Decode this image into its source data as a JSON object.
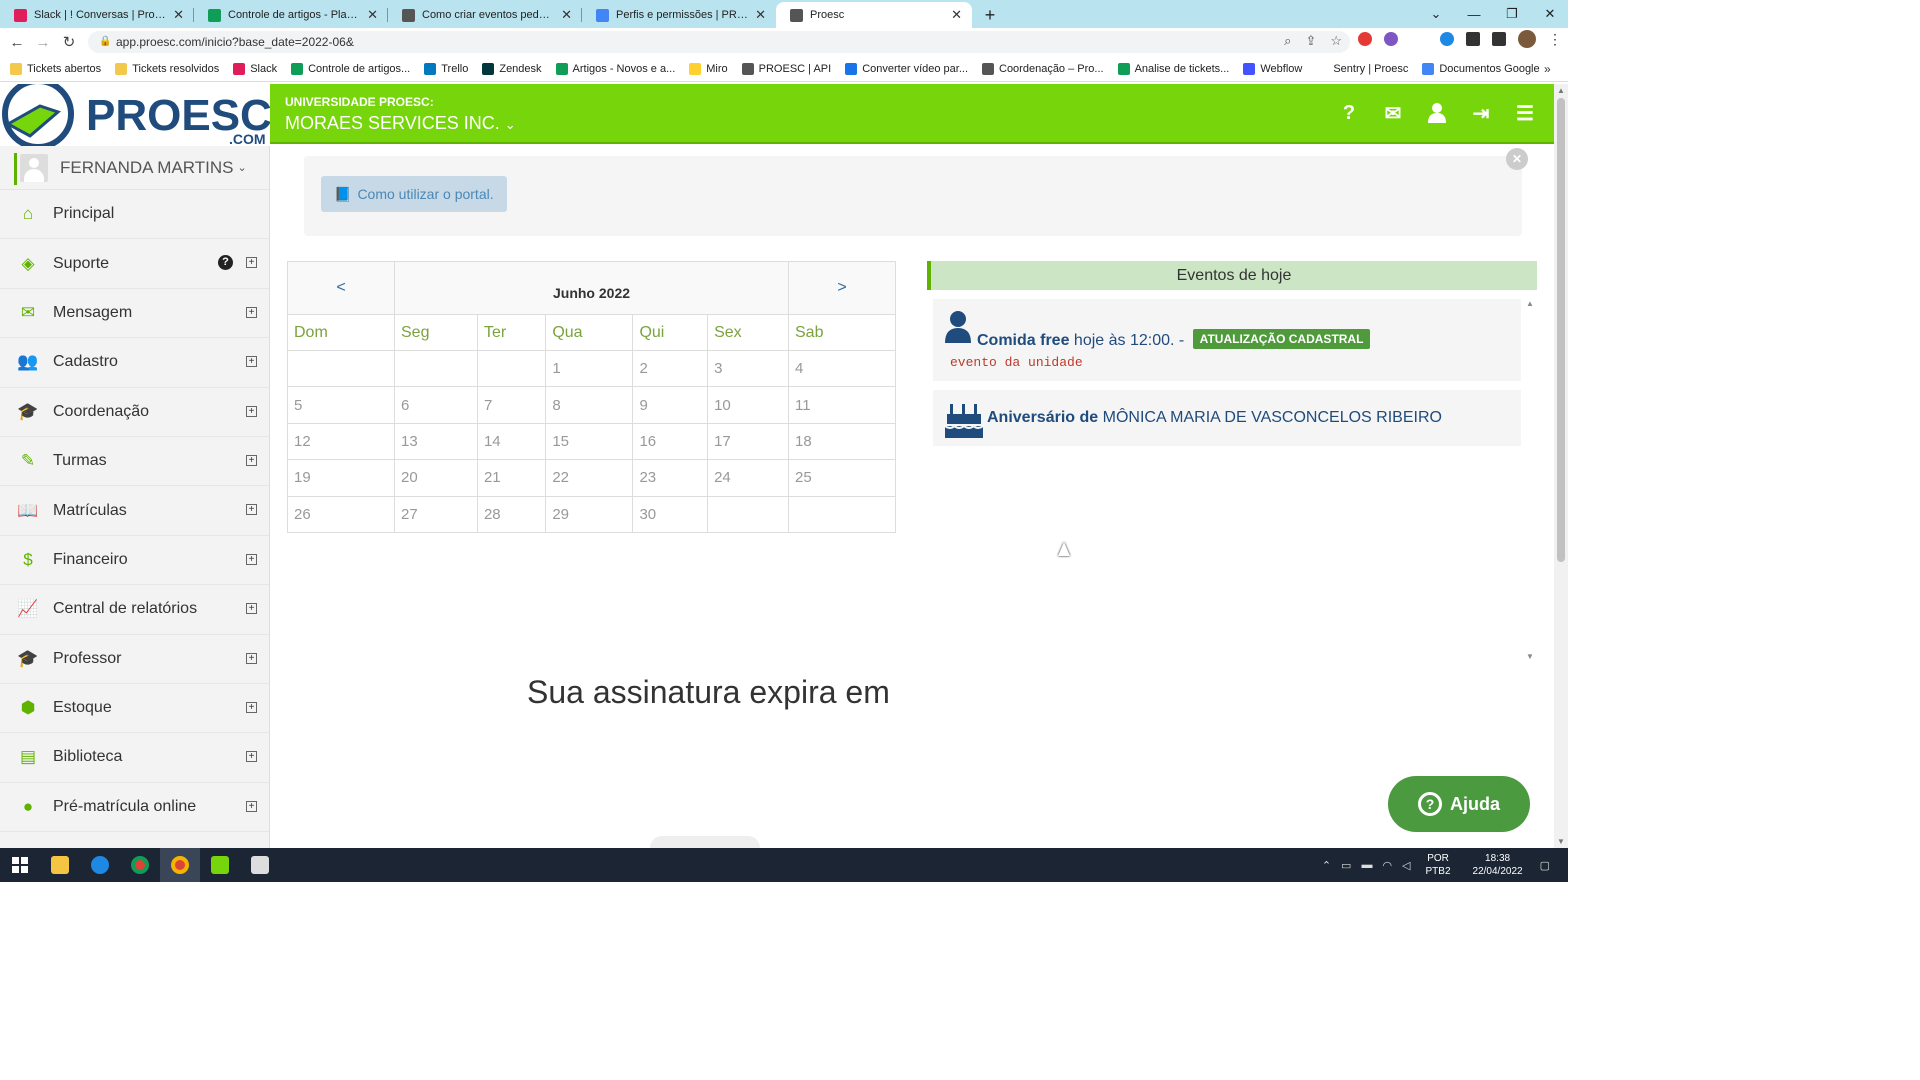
{
  "browser": {
    "tabs": [
      {
        "label": "Slack | ! Conversas | Proesc.com |",
        "color": "#e01e5a"
      },
      {
        "label": "Controle de artigos - Planilhas G",
        "color": "#0f9d58"
      },
      {
        "label": "Como criar eventos pedagógicos",
        "color": "#555555"
      },
      {
        "label": "Perfis e permissões | PROESC - D",
        "color": "#4285f4"
      },
      {
        "label": "Proesc",
        "color": "#555555"
      }
    ],
    "url": "app.proesc.com/inicio?base_date=2022-06&",
    "bookmarks": [
      {
        "label": "Tickets abertos",
        "color": "#f2c94c"
      },
      {
        "label": "Tickets resolvidos",
        "color": "#f2c94c"
      },
      {
        "label": "Slack",
        "color": "#e01e5a"
      },
      {
        "label": "Controle de artigos...",
        "color": "#0f9d58"
      },
      {
        "label": "Trello",
        "color": "#0079bf"
      },
      {
        "label": "Zendesk",
        "color": "#03363d"
      },
      {
        "label": "Artigos - Novos e a...",
        "color": "#0f9d58"
      },
      {
        "label": "Miro",
        "color": "#ffd02f"
      },
      {
        "label": "PROESC | API",
        "color": "#555555"
      },
      {
        "label": "Converter vídeo par...",
        "color": "#1a73e8"
      },
      {
        "label": "Coordenação – Pro...",
        "color": "#555555"
      },
      {
        "label": "Analise de tickets...",
        "color": "#0f9d58"
      },
      {
        "label": "Webflow",
        "color": "#4353ff"
      },
      {
        "label": "Sentry | Proesc",
        "color": "#ffffff"
      },
      {
        "label": "Documentos Google",
        "color": "#4285f4"
      }
    ]
  },
  "header": {
    "university_label": "UNIVERSIDADE PROESC:",
    "company": "MORAES SERVICES INC.",
    "logo_text": "PROESC",
    "logo_suffix": ".COM"
  },
  "sidebar": {
    "user": "FERNANDA MARTINS",
    "items": [
      {
        "label": "Principal",
        "icon": "home-icon",
        "glyph": "⌂"
      },
      {
        "label": "Suporte",
        "icon": "ticket-icon",
        "glyph": "◈"
      },
      {
        "label": "Mensagem",
        "icon": "envelope-icon",
        "glyph": "✉"
      },
      {
        "label": "Cadastro",
        "icon": "users-icon",
        "glyph": "👥"
      },
      {
        "label": "Coordenação",
        "icon": "graduation-cap-icon",
        "glyph": "🎓"
      },
      {
        "label": "Turmas",
        "icon": "pencil-icon",
        "glyph": "✎"
      },
      {
        "label": "Matrículas",
        "icon": "book-icon",
        "glyph": "📖"
      },
      {
        "label": "Financeiro",
        "icon": "money-icon",
        "glyph": "$"
      },
      {
        "label": "Central de relatórios",
        "icon": "line-chart-icon",
        "glyph": "📈"
      },
      {
        "label": "Professor",
        "icon": "graduation-cap-icon",
        "glyph": "🎓"
      },
      {
        "label": "Estoque",
        "icon": "cube-icon",
        "glyph": "⬢"
      },
      {
        "label": "Biblioteca",
        "icon": "archive-icon",
        "glyph": "▤"
      },
      {
        "label": "Pré-matrícula online",
        "icon": "globe-icon",
        "glyph": "●"
      }
    ]
  },
  "main": {
    "portal_button": "Como utilizar o portal.",
    "calendar": {
      "prev": "<",
      "next": ">",
      "title": "Junho 2022",
      "days_of_week": [
        "Dom",
        "Seg",
        "Ter",
        "Qua",
        "Qui",
        "Sex",
        "Sab"
      ],
      "weeks": [
        [
          "",
          "",
          "",
          "1",
          "2",
          "3",
          "4"
        ],
        [
          "5",
          "6",
          "7",
          "8",
          "9",
          "10",
          "11"
        ],
        [
          "12",
          "13",
          "14",
          "15",
          "16",
          "17",
          "18"
        ],
        [
          "19",
          "20",
          "21",
          "22",
          "23",
          "24",
          "25"
        ],
        [
          "26",
          "27",
          "28",
          "29",
          "30",
          "",
          ""
        ]
      ]
    },
    "events": {
      "title": "Eventos de hoje",
      "event1": {
        "name": "Comida free",
        "time": "hoje às 12:00. -",
        "badge": "ATUALIZAÇÃO CADASTRAL",
        "description": "evento da unidade"
      },
      "event2": {
        "prefix": "Aniversário de",
        "person": "MÔNICA MARIA DE VASCONCELOS RIBEIRO"
      }
    },
    "subscription_text": "Sua assinatura expira em",
    "help_button": "Ajuda"
  },
  "taskbar": {
    "lang_top": "POR",
    "lang_bottom": "PTB2",
    "time": "18:38",
    "date": "22/04/2022"
  },
  "colors": {
    "brand_green": "#76d50b",
    "dark_blue": "#1f4b7d",
    "badge_green": "#4f9a3a"
  }
}
